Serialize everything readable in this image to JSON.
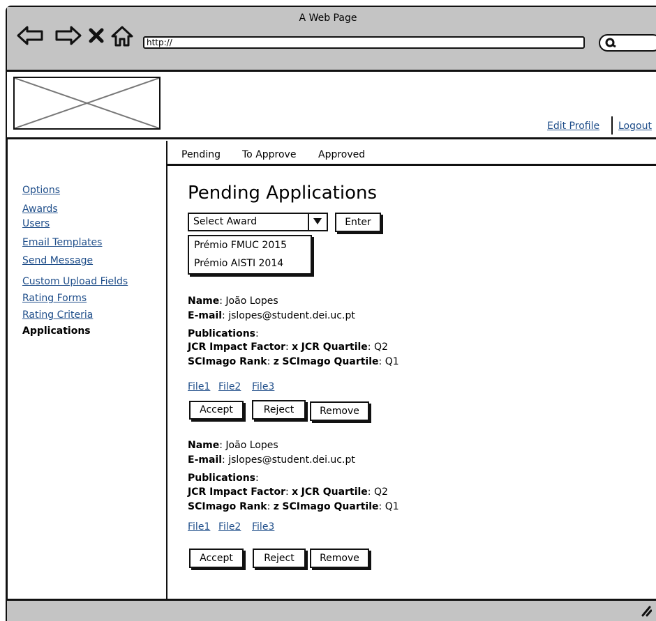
{
  "window": {
    "title": "A Web Page"
  },
  "browser": {
    "url": "http://",
    "nav_icons": [
      "back-arrow-icon",
      "forward-arrow-icon",
      "stop-x-icon",
      "home-icon"
    ],
    "search_icon": "search-icon"
  },
  "header": {
    "logo": "image-placeholder",
    "edit_profile": "Edit Profile",
    "logout": "Logout"
  },
  "tabs": [
    "Pending",
    "To Approve",
    "Approved"
  ],
  "sidebar": {
    "items": [
      "Options",
      "Awards",
      "Users",
      "Email Templates",
      "Send Message",
      "Custom Upload Fields",
      "Rating Forms",
      "Rating Criteria",
      "Applications"
    ],
    "active": "Applications"
  },
  "main": {
    "title": "Pending Applications",
    "select_placeholder": "Select Award",
    "enter_label": "Enter",
    "dropdown_options": [
      "Prémio FMUC 2015",
      "Prémio AISTI 2014"
    ]
  },
  "labels": {
    "name": "Name",
    "email": "E-mail",
    "publications": "Publications",
    "jcr_impact": "JCR Impact Factor",
    "jcr_quartile": "JCR Quartile",
    "scimago_rank": "SCImago Rank",
    "scimago_quartile": "SCImago Quartile"
  },
  "applications": [
    {
      "name": "João Lopes",
      "email": "jslopes@student.dei.uc.pt",
      "jcr_impact": "x",
      "jcr_quartile": "Q2",
      "scimago_rank": "z",
      "scimago_quartile": "Q1",
      "files": [
        "File1",
        "File2",
        "File3"
      ],
      "actions": [
        "Accept",
        "Reject",
        "Remove"
      ]
    },
    {
      "name": "João Lopes",
      "email": "jslopes@student.dei.uc.pt",
      "jcr_impact": "x",
      "jcr_quartile": "Q2",
      "scimago_rank": "z",
      "scimago_quartile": "Q1",
      "files": [
        "File1",
        "File2",
        "File3"
      ],
      "actions": [
        "Accept",
        "Reject",
        "Remove"
      ]
    }
  ]
}
